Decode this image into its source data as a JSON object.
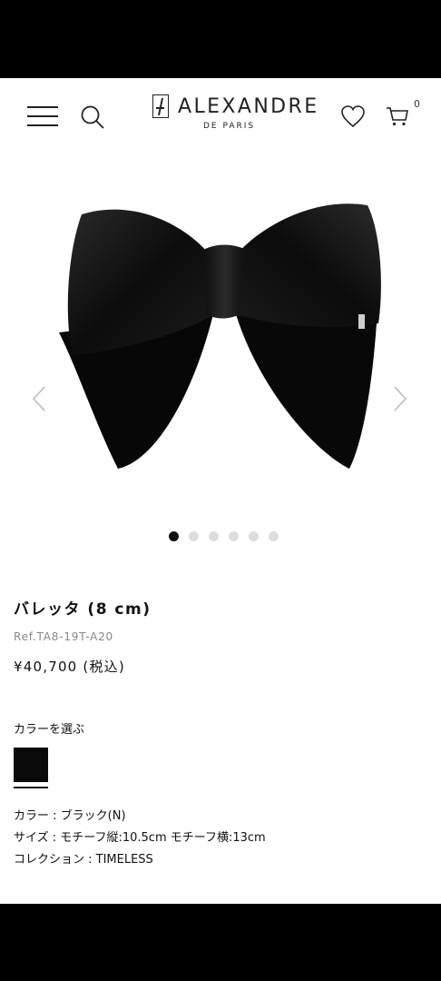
{
  "header": {
    "logo_name": "ALEXANDRE",
    "logo_sub": "DE PARIS",
    "cart_count": "0"
  },
  "carousel": {
    "slide_count": 6,
    "active_index": 0
  },
  "product": {
    "name": "バレッタ (8 cm)",
    "ref": "Ref.TA8-19T-A20",
    "price": "¥40,700 (税込)"
  },
  "color_select": {
    "heading": "カラーを選ぶ",
    "selected_color": "#0a0a0a"
  },
  "specs": {
    "color": "カラー : ブラック(N)",
    "size": "サイズ : モチーフ縦:10.5cm モチーフ横:13cm",
    "collection": "コレクション : TIMELESS"
  }
}
